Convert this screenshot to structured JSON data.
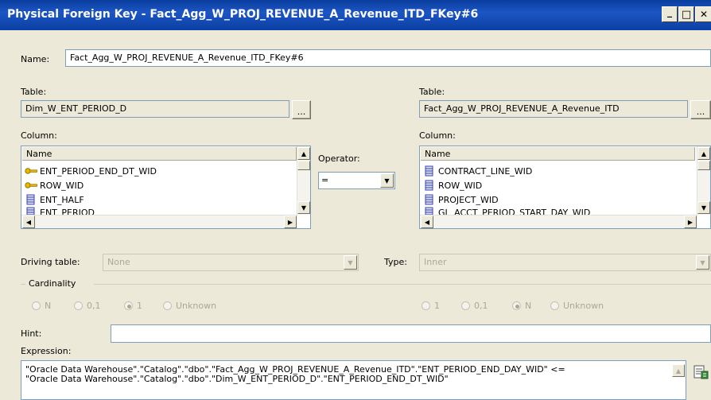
{
  "window": {
    "title": "Physical Foreign Key - Fact_Agg_W_PROJ_REVENUE_A_Revenue_ITD_FKey#6",
    "minimize_glyph": "_",
    "maximize_glyph": "□",
    "close_glyph": "✕"
  },
  "name": {
    "label": "Name:",
    "value": "Fact_Agg_W_PROJ_REVENUE_A_Revenue_ITD_FKey#6"
  },
  "left": {
    "table_label": "Table:",
    "table_value": "Dim_W_ENT_PERIOD_D",
    "browse_label": "...",
    "column_label": "Column:",
    "header": "Name",
    "rows": [
      {
        "icon": "key-icon",
        "label": "ENT_PERIOD_END_DT_WID"
      },
      {
        "icon": "key-icon",
        "label": "ROW_WID"
      },
      {
        "icon": "column-icon",
        "label": "ENT_HALF"
      },
      {
        "icon": "column-icon",
        "label": "ENT_PERIOD"
      }
    ]
  },
  "operator": {
    "label": "Operator:",
    "value": "="
  },
  "right": {
    "table_label": "Table:",
    "table_value": "Fact_Agg_W_PROJ_REVENUE_A_Revenue_ITD",
    "browse_label": "...",
    "column_label": "Column:",
    "header": "Name",
    "rows": [
      {
        "icon": "column-icon",
        "label": "CONTRACT_LINE_WID"
      },
      {
        "icon": "column-icon",
        "label": "ROW_WID"
      },
      {
        "icon": "column-icon",
        "label": "PROJECT_WID"
      },
      {
        "icon": "column-icon",
        "label": "GL_ACCT_PERIOD_START_DAY_WID"
      }
    ]
  },
  "driving": {
    "label": "Driving table:",
    "value": "None"
  },
  "type": {
    "label": "Type:",
    "value": "Inner"
  },
  "cardinality": {
    "label": "Cardinality",
    "left_options": [
      "N",
      "0,1",
      "1",
      "Unknown"
    ],
    "left_selected": "1",
    "right_options": [
      "1",
      "0,1",
      "N",
      "Unknown"
    ],
    "right_selected": "N"
  },
  "hint": {
    "label": "Hint:",
    "value": ""
  },
  "expression": {
    "label": "Expression:",
    "line1": "\"Oracle Data Warehouse\".\"Catalog\".\"dbo\".\"Fact_Agg_W_PROJ_REVENUE_A_Revenue_ITD\".\"ENT_PERIOD_END_DAY_WID\" <=",
    "line2": "\"Oracle Data Warehouse\".\"Catalog\".\"dbo\".\"Dim_W_ENT_PERIOD_D\".\"ENT_PERIOD_END_DT_WID\""
  },
  "colors": {
    "titlebar": "#0a3e9e",
    "dialog_bg": "#ece9d8",
    "border": "#7f9db9"
  }
}
